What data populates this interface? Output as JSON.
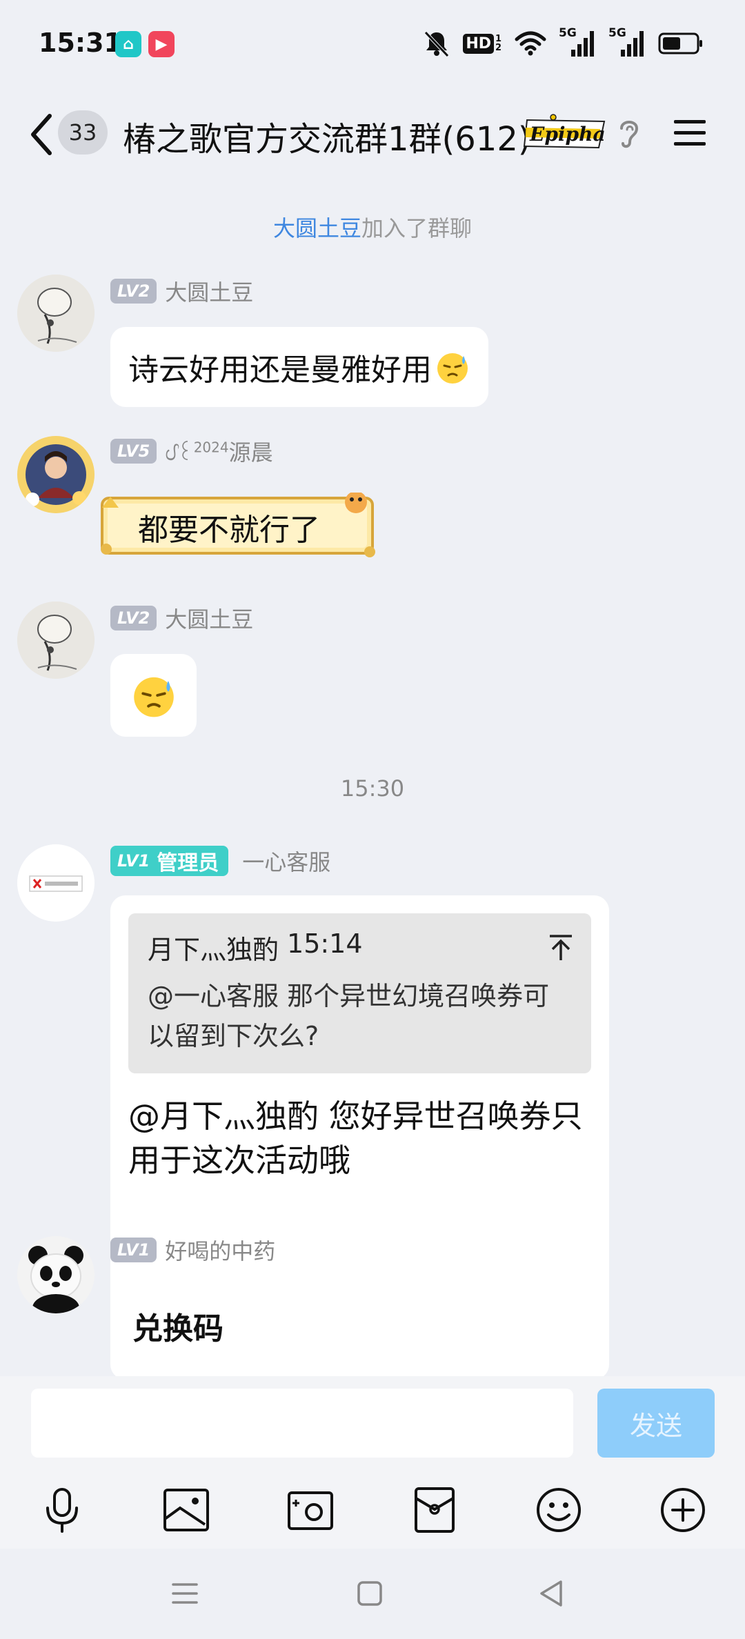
{
  "status_bar": {
    "time": "15:31",
    "app_icons": [
      "home-app-icon",
      "video-app-icon"
    ],
    "indicators": [
      "mute-icon",
      "hd-icon",
      "wifi-icon",
      "signal-5g-icon",
      "signal-5g-icon",
      "battery-icon"
    ],
    "hd_label": "HD",
    "hd_sub": "1 2",
    "network1": "5G",
    "network2": "5G"
  },
  "header": {
    "unread_count": "33",
    "title": "椿之歌官方交流群1群(612)",
    "badge_text": "Epiphany"
  },
  "chat": {
    "system_join": {
      "name": "大圆土豆",
      "text": "加入了群聊"
    },
    "time_separator": "15:30",
    "messages": [
      {
        "level": "LV2",
        "sender": "大圆土豆",
        "text": "诗云好用还是曼雅好用",
        "emoji": "sweat-emoji"
      },
      {
        "level": "LV5",
        "sender_prefix": "ᦔ꒰",
        "sender_year": "2024",
        "sender": "源晨",
        "text": "都要不就行了",
        "bubble_style": "scroll"
      },
      {
        "level": "LV2",
        "sender": "大圆土豆",
        "emoji": "sweat-emoji"
      },
      {
        "level": "LV1",
        "role": "管理员",
        "sender": "一心客服",
        "quote": {
          "author": "月下灬独酌",
          "time": "15:14",
          "text": "@一心客服 那个异世幻境召唤券可以留到下次么?"
        },
        "text": "@月下灬独酌 您好异世召唤券只用于这次活动哦"
      },
      {
        "level": "LV1",
        "sender": "好喝的中药",
        "text": "兑换码"
      }
    ]
  },
  "input": {
    "placeholder": "",
    "send_label": "发送"
  },
  "toolbar": [
    "microphone-icon",
    "image-icon",
    "camera-icon",
    "red-packet-icon",
    "emoji-icon",
    "plus-icon"
  ],
  "colors": {
    "accent": "#3f87e0",
    "send_disabled": "#8ecdfa",
    "admin_tag": "#3fcfc8",
    "background": "#eef0f5"
  }
}
